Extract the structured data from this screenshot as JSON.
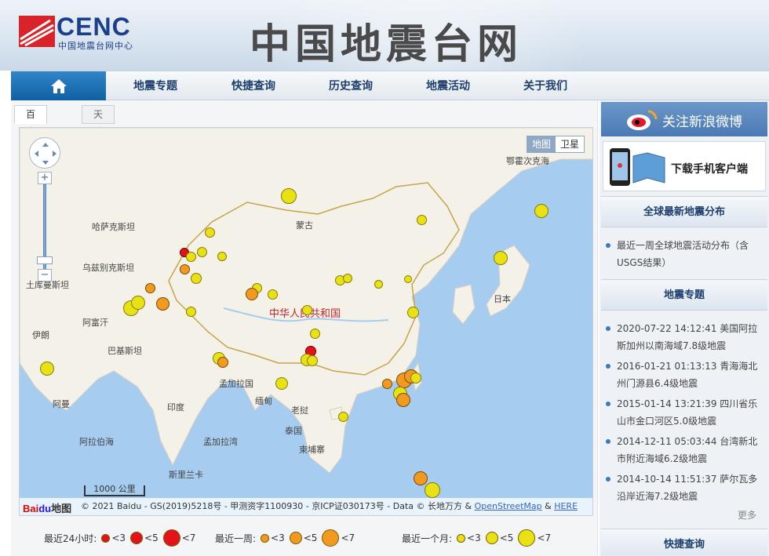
{
  "header": {
    "logo_text": "CENC",
    "logo_sub": "中国地震台网中心",
    "site_title": "中国地震台网"
  },
  "nav": {
    "home_icon": "home-icon",
    "items": [
      {
        "label": "地震专题"
      },
      {
        "label": "快捷查询"
      },
      {
        "label": "历史查询"
      },
      {
        "label": "地震活动"
      },
      {
        "label": "关于我们"
      }
    ]
  },
  "map": {
    "tabs": [
      {
        "label": "百度地图",
        "active": true
      },
      {
        "label": "天地图",
        "active": false
      }
    ],
    "maptype": {
      "map": "地图",
      "satellite": "卫星"
    },
    "scale": "1000 公里",
    "attribution_prefix": "© 2021 Baidu - GS(2019)5218号 - 甲测资字1100930 - 京ICP证030173号 - Data © 长地万方 & ",
    "attribution_osm": "OpenStreetMap",
    "attribution_and": " & ",
    "attribution_here": "HERE",
    "baidu_logo": "Baidu地图",
    "labels": {
      "okhotsk": "鄂霍次克海",
      "kazakh": "哈萨克斯坦",
      "mongolia": "蒙古",
      "uzbek": "乌兹别克斯坦",
      "turkmen": "土库曼斯坦",
      "afghan": "阿富汗",
      "iran": "伊朗",
      "pakistan": "巴基斯坦",
      "china": "中华人民共和国",
      "japan": "日本",
      "bangla": "孟加拉国",
      "myanmar": "缅甸",
      "india": "印度",
      "laos": "老挝",
      "thailand": "泰国",
      "cambodia": "柬埔寨",
      "oman": "阿曼",
      "arabian": "阿拉伯海",
      "bengal": "孟加拉湾",
      "srilanka": "斯里兰卡"
    }
  },
  "legend": {
    "day": {
      "label": "最近24小时:",
      "color": "#e3121b",
      "items": [
        "<3",
        "<5",
        "<7"
      ]
    },
    "week": {
      "label": "最近一周:",
      "color": "#f29a1f",
      "items": [
        "<3",
        "<5",
        "<7"
      ]
    },
    "month": {
      "label": "最近一个月:",
      "color": "#e8e214",
      "items": [
        "<3",
        "<5",
        "<7"
      ]
    }
  },
  "sidebar": {
    "weibo": "关注新浪微博",
    "app_download": "下载手机客户端",
    "global_head": "全球最新地震分布",
    "global_items": [
      "最近一周全球地震活动分布（含USGS结果）"
    ],
    "topic_head": "地震专题",
    "topic_items": [
      "2020-07-22 14:12:41 美国阿拉斯加州以南海域7.8级地震",
      "2016-01-21 01:13:13 青海海北州门源县6.4级地震",
      "2015-01-14 13:21:39 四川省乐山市金口河区5.0级地震",
      "2014-12-11 05:03:44 台湾新北市附近海域6.2级地震",
      "2014-10-14 11:51:37 萨尔瓦多沿岸近海7.2级地震"
    ],
    "more": "更多",
    "quick_head": "快捷查询"
  }
}
